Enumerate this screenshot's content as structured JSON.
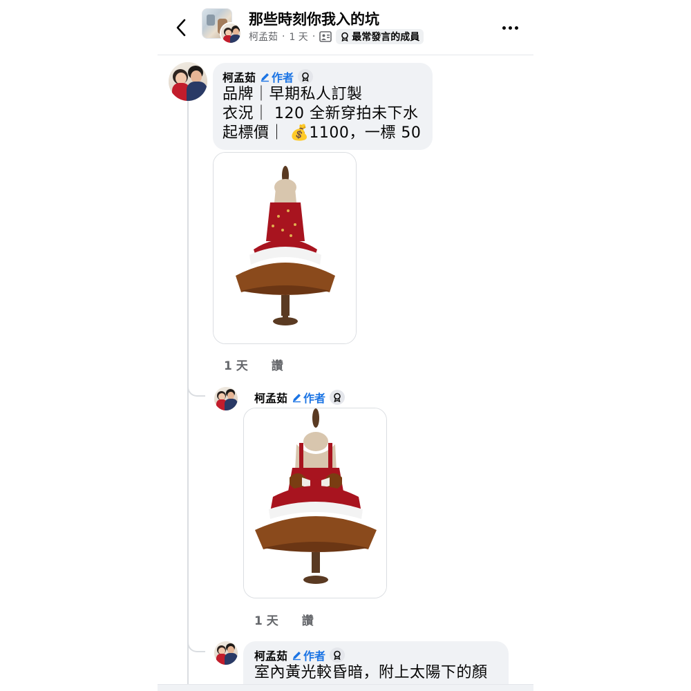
{
  "header": {
    "title": "那些時刻你我入的坑",
    "author": "柯孟茹",
    "sep": "·",
    "time": "1 天",
    "member_badge": "最常發言的成員"
  },
  "comments": [
    {
      "author": "柯孟茹",
      "author_tag": "作者",
      "lines": [
        "品牌｜早期私人訂製",
        "衣況｜ 120 全新穿拍未下水",
        "起標價｜ 💰1100，一標 50"
      ],
      "time": "1 天",
      "like_label": "讚"
    },
    {
      "author": "柯孟茹",
      "author_tag": "作者",
      "time": "1 天",
      "like_label": "讚"
    },
    {
      "author": "柯孟茹",
      "author_tag": "作者",
      "lines": [
        "室內黃光較昏暗，附上太陽下的顏"
      ]
    }
  ],
  "colors": {
    "accent_blue": "#1b74e4",
    "bubble_bg": "#f0f2f5",
    "muted_text": "#65676b",
    "dress_red": "#a8141f",
    "tulle_brown": "#8a4a1c"
  },
  "icons": [
    "back-chevron-icon",
    "group-thumbnail",
    "group-members-icon",
    "top-contributor-badge-icon",
    "more-options-icon",
    "author-pencil-icon"
  ]
}
